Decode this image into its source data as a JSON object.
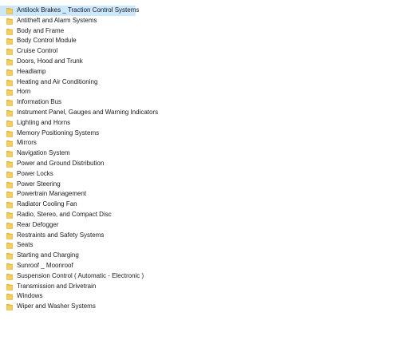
{
  "file_list": {
    "icon": "folder-icon",
    "folder_color": "#f5cf5b",
    "folder_stroke": "#d8a923",
    "selected_color": "#cce8ff",
    "items": [
      {
        "label": "Antilock Brakes _ Traction Control Systems",
        "selected": true
      },
      {
        "label": "Antitheft and Alarm Systems"
      },
      {
        "label": "Body and Frame"
      },
      {
        "label": "Body Control Module"
      },
      {
        "label": "Cruise Control"
      },
      {
        "label": "Doors, Hood and Trunk"
      },
      {
        "label": "Headlamp"
      },
      {
        "label": "Heating and Air Conditioning"
      },
      {
        "label": "Horn"
      },
      {
        "label": "Information Bus"
      },
      {
        "label": "Instrument Panel, Gauges and Warning Indicators"
      },
      {
        "label": "Lighting and Horns"
      },
      {
        "label": "Memory Positioning Systems"
      },
      {
        "label": "Mirrors"
      },
      {
        "label": "Navigation System"
      },
      {
        "label": "Power and Ground Distribution"
      },
      {
        "label": "Power Locks"
      },
      {
        "label": "Power Steering"
      },
      {
        "label": "Powertrain Management"
      },
      {
        "label": "Radiator Cooling Fan"
      },
      {
        "label": "Radio, Stereo, and Compact Disc"
      },
      {
        "label": "Rear Defogger"
      },
      {
        "label": "Restraints and Safety Systems"
      },
      {
        "label": "Seats"
      },
      {
        "label": "Starting and Charging"
      },
      {
        "label": "Sunroof _ Moonroof"
      },
      {
        "label": "Suspension Control ( Automatic - Electronic )"
      },
      {
        "label": "Transmission and Drivetrain"
      },
      {
        "label": "Windows"
      },
      {
        "label": "Wiper and Washer Systems"
      }
    ]
  }
}
